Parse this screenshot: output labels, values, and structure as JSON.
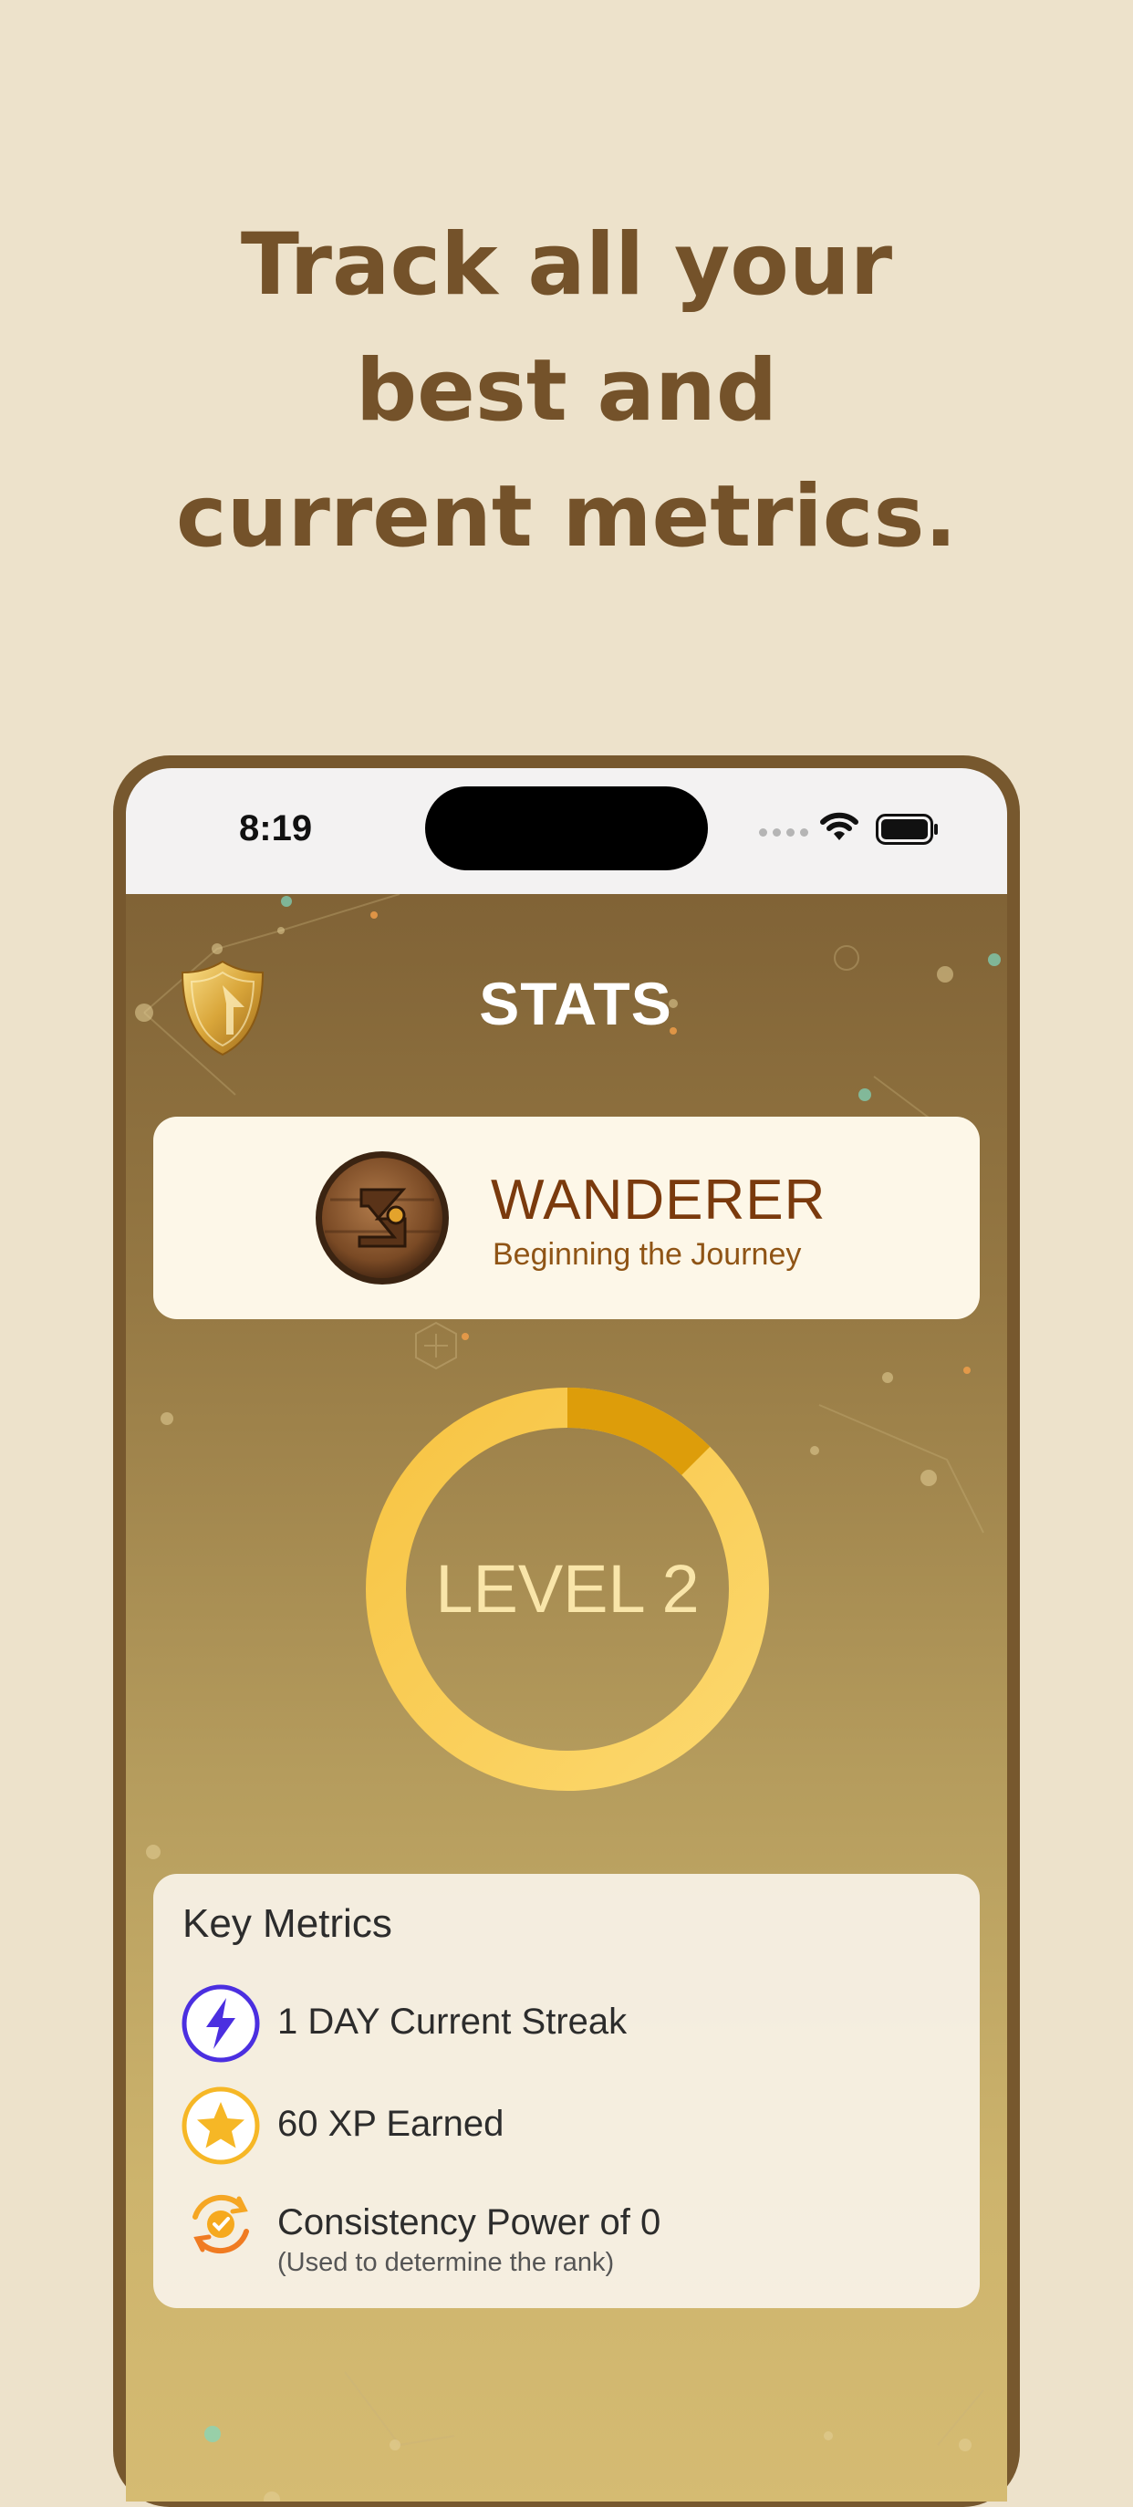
{
  "headline": {
    "lines": [
      "Track all your",
      "best and",
      "current metrics."
    ]
  },
  "status_bar": {
    "time": "8:19"
  },
  "header": {
    "title": "STATS"
  },
  "rank": {
    "name": "WANDERER",
    "subtitle": "Beginning the Journey"
  },
  "level": {
    "label": "LEVEL 2",
    "progress_fraction": 0.125
  },
  "metrics": {
    "title": "Key Metrics",
    "items": [
      {
        "icon": "lightning-icon",
        "text": "1 DAY Current Streak"
      },
      {
        "icon": "star-icon",
        "text": "60 XP Earned"
      },
      {
        "icon": "consistency-icon",
        "text": "Consistency Power of 0",
        "note": "(Used to determine the rank)"
      }
    ]
  },
  "colors": {
    "background": "#ede2cb",
    "headline": "#74522a",
    "phone_frame": "#77582e",
    "rank_name": "#7a3a0d",
    "ring_base": "#fbc74e",
    "ring_progress": "#dd9d0a",
    "lightning_accent": "#4b2fe0",
    "star_accent": "#f6b726"
  }
}
